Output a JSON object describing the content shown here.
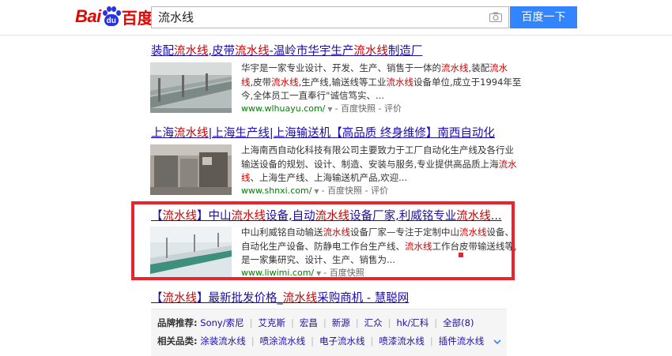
{
  "header": {
    "logo_bai": "Bai",
    "logo_du": "du",
    "logo_baidu": "百度",
    "search_query": "流水线",
    "search_button": "百度一下"
  },
  "results": [
    {
      "title_parts": [
        {
          "t": "装配",
          "hl": false
        },
        {
          "t": "流水线",
          "hl": true
        },
        {
          "t": ",皮带",
          "hl": false
        },
        {
          "t": "流水线",
          "hl": true
        },
        {
          "t": "-温岭市华宇生产",
          "hl": false
        },
        {
          "t": "流水线",
          "hl": true
        },
        {
          "t": "制造厂",
          "hl": false
        }
      ],
      "snippet_lines": [
        [
          {
            "t": "华宇是一家专业设计、开发、生产、销售于一体的",
            "hl": false
          },
          {
            "t": "流水线",
            "hl": true
          },
          {
            "t": ",装配",
            "hl": false
          },
          {
            "t": "流水",
            "hl": true
          }
        ],
        [
          {
            "t": "线",
            "hl": true
          },
          {
            "t": ",皮带",
            "hl": false
          },
          {
            "t": "流水线",
            "hl": true
          },
          {
            "t": ",生产线,输送线等工业",
            "hl": false
          },
          {
            "t": "流水线",
            "hl": true
          },
          {
            "t": "设备单位,成立于1994年至",
            "hl": false
          }
        ],
        [
          {
            "t": "今,全体员工一直奉行\"诚信笃实、...",
            "hl": false
          }
        ]
      ],
      "url": "www.wlhuayu.com/",
      "cache": "百度快照",
      "review": "评价"
    },
    {
      "title_parts": [
        {
          "t": "上海",
          "hl": false
        },
        {
          "t": "流水线",
          "hl": true
        },
        {
          "t": "|上海生产线|上海输送机【高品质 终身维修】南西自动化",
          "hl": false
        }
      ],
      "snippet_lines": [
        [
          {
            "t": "上海南西自动化科技有限公司主要致力于工厂自动化生产线及各行业",
            "hl": false
          }
        ],
        [
          {
            "t": "输送设备的规划、设计、制造、安装与服务,专业提供高品质上海",
            "hl": false
          },
          {
            "t": "流水",
            "hl": true
          }
        ],
        [
          {
            "t": "线",
            "hl": true
          },
          {
            "t": "、上海生产线、上海输送机产品,欢迎...",
            "hl": false
          }
        ]
      ],
      "url": "www.shnxi.com/",
      "cache": "百度快照",
      "review": "评价"
    },
    {
      "title_parts": [
        {
          "t": "【",
          "hl": false
        },
        {
          "t": "流水线",
          "hl": true
        },
        {
          "t": "】中山",
          "hl": false
        },
        {
          "t": "流水线",
          "hl": true
        },
        {
          "t": "设备,自动",
          "hl": false
        },
        {
          "t": "流水线",
          "hl": true
        },
        {
          "t": "设备厂家,利威铭专业",
          "hl": false
        },
        {
          "t": "流水线",
          "hl": true
        },
        {
          "t": "...",
          "hl": false
        }
      ],
      "snippet_lines": [
        [
          {
            "t": "中山利威铭自动输送",
            "hl": false
          },
          {
            "t": "流水线",
            "hl": true
          },
          {
            "t": "设备厂家—专注于定制中山",
            "hl": false
          },
          {
            "t": "流水线",
            "hl": true
          },
          {
            "t": "设备、",
            "hl": false
          }
        ],
        [
          {
            "t": "自动化生产设备、防静电工作台生产线、",
            "hl": false
          },
          {
            "t": "流水线",
            "hl": true
          },
          {
            "t": "工作台皮带输送线等,",
            "hl": false
          }
        ],
        [
          {
            "t": "是一家集研究、设计、生产、销售为...",
            "hl": false
          }
        ]
      ],
      "url": "www.liwimi.com/",
      "cache": "百度快照",
      "review": ""
    },
    {
      "title_parts": [
        {
          "t": "【",
          "hl": false
        },
        {
          "t": "流水线",
          "hl": true
        },
        {
          "t": "】最新批发价格_",
          "hl": false
        },
        {
          "t": "流水线",
          "hl": true
        },
        {
          "t": "采购商机 - 慧聪网",
          "hl": false
        }
      ]
    }
  ],
  "related": {
    "brand_label": "品牌推荐:",
    "brands": [
      "Sony/索尼",
      "艾克斯",
      "宏昌",
      "新源",
      "汇众",
      "hk/汇科",
      "全部(8)"
    ],
    "category_label": "相关品类:",
    "categories": [
      "涂装流水线",
      "喷涂流水线",
      "电子流水线",
      "喷漆流水线",
      "插件流水线"
    ]
  },
  "colors": {
    "link": "#1a0dab",
    "highlight": "#c00",
    "url_green": "#008000",
    "search_button": "#3385ff",
    "box_red": "#e8242c"
  }
}
